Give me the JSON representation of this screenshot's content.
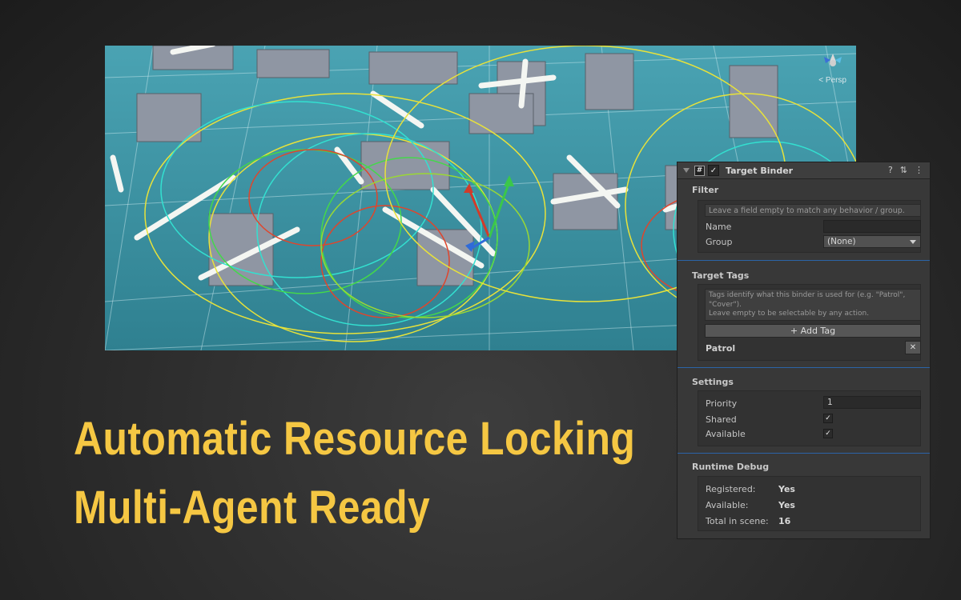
{
  "scene": {
    "view_label": "< Persp"
  },
  "headline": {
    "line1": "Automatic Resource Locking",
    "line2": "Multi-Agent Ready"
  },
  "inspector": {
    "component_title": "Target Binder",
    "header_icons": [
      "help-icon",
      "preset-icon",
      "kebab-menu-icon"
    ],
    "filter": {
      "title": "Filter",
      "hint": "Leave a field empty to match any behavior / group.",
      "name_label": "Name",
      "name_value": "",
      "group_label": "Group",
      "group_value": "(None)"
    },
    "target_tags": {
      "title": "Target Tags",
      "hint": "Tags identify what this binder is used for (e.g. \"Patrol\", \"Cover\").\nLeave empty to be selectable by any action.",
      "add_button": "+ Add Tag",
      "tags": [
        "Patrol"
      ],
      "remove_label": "✕"
    },
    "settings": {
      "title": "Settings",
      "priority_label": "Priority",
      "priority_value": "1",
      "shared_label": "Shared",
      "shared_checked": true,
      "available_label": "Available",
      "available_checked": true
    },
    "runtime_debug": {
      "title": "Runtime Debug",
      "rows": [
        {
          "label": "Registered:",
          "value": "Yes"
        },
        {
          "label": "Available:",
          "value": "Yes"
        },
        {
          "label": "Total in scene:",
          "value": "16"
        }
      ]
    }
  },
  "colors": {
    "headline": "#f5c743",
    "scene_bg": "#3a8fa0",
    "separator": "#2b64a8",
    "panel_bg": "#383838"
  }
}
